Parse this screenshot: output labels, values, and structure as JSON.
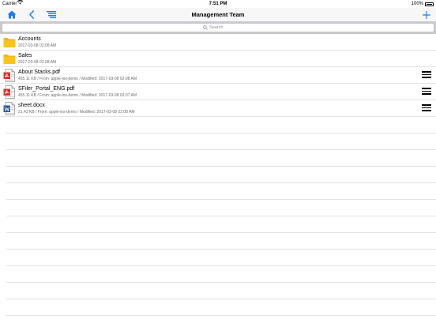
{
  "status": {
    "carrier": "Carrier",
    "time": "7:51 PM",
    "battery": "100%"
  },
  "nav": {
    "title": "Management Team",
    "icons": {
      "home": "home-icon",
      "back": "chevron-left-icon",
      "list": "list-icon",
      "add": "plus-icon"
    },
    "accent": "#1e7cf2"
  },
  "search": {
    "placeholder": "Search"
  },
  "items": [
    {
      "type": "folder",
      "name": "Accounts",
      "meta": "2017-03-08 02:08 AM",
      "has_menu": false
    },
    {
      "type": "folder",
      "name": "Sales",
      "meta": "2017-03-08 02:08 AM",
      "has_menu": false
    },
    {
      "type": "pdf",
      "name": "About Stacks.pdf",
      "meta": "455.11 KB / From: apple-ios-demo / Modified: 2017-03-08 02:08 AM",
      "has_menu": true
    },
    {
      "type": "pdf",
      "name": "SFiler_Portal_ENG.pdf",
      "meta": "455.11 KB / From: apple-ios-demo / Modified: 2017-03-08 02:07 AM",
      "has_menu": true
    },
    {
      "type": "docx",
      "name": "sheet.docx",
      "meta": "21.43 KB / From: apple-ios-demo / Modified: 2017-03-08 02:08 AM",
      "has_menu": true
    }
  ],
  "colors": {
    "folder": "#f5b31a",
    "pdf": "#d9342b",
    "docx": "#2b5797"
  }
}
